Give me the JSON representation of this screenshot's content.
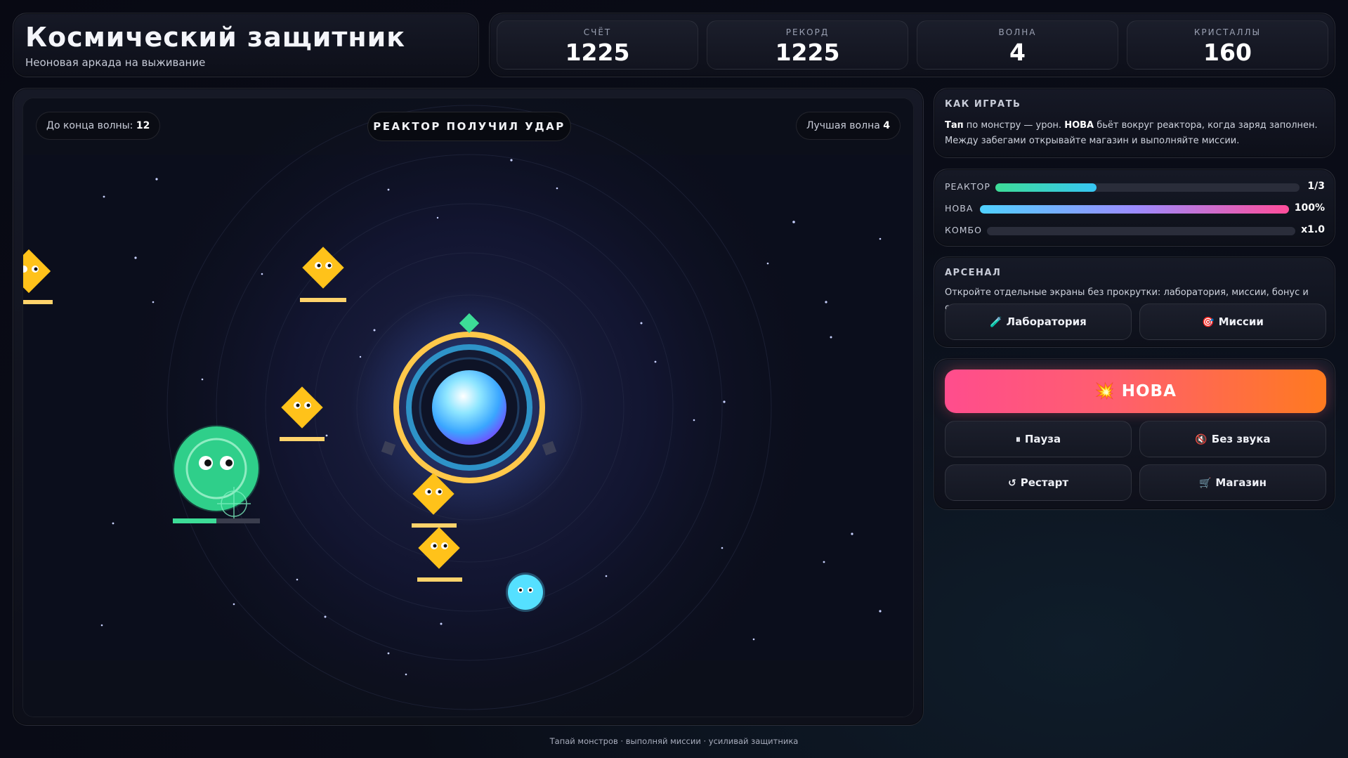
{
  "header": {
    "title": "Космический защитник",
    "subtitle": "Неоновая аркада на выживание"
  },
  "stats": [
    {
      "label": "СЧЁТ",
      "value": "1225"
    },
    {
      "label": "РЕКОРД",
      "value": "1225"
    },
    {
      "label": "ВОЛНА",
      "value": "4"
    },
    {
      "label": "КРИСТАЛЛЫ",
      "value": "160"
    }
  ],
  "game": {
    "wave_left_label": "До конца волны:",
    "wave_left_value": "12",
    "hit_message": "РЕАКТОР ПОЛУЧИЛ УДАР",
    "best_wave_label": "Лучшая волна",
    "best_wave_value": "4",
    "boss_health_fraction": 0.5
  },
  "howto": {
    "title": "КАК ИГРАТЬ",
    "tap": "Тап",
    "text1": " по монстру — урон. ",
    "nova": "НОВА",
    "text2": " бьёт вокруг реактора, когда заряд заполнен. Между забегами открывайте магазин и выполняйте миссии."
  },
  "bars": {
    "reactor": {
      "label": "РЕАКТОР",
      "value": "1/3",
      "fraction": 0.333,
      "color_from": "#3ddc97",
      "color_to": "#37c6f4"
    },
    "nova": {
      "label": "НОВА",
      "value": "100%",
      "fraction": 1.0,
      "color_from": "#4fd1ff",
      "color_to": "#ff4d9a"
    },
    "combo": {
      "label": "КОМБО",
      "value": "x1.0",
      "fraction": 0.0
    }
  },
  "arsenal": {
    "title": "АРСЕНАЛ",
    "text": "Откройте отдельные экраны без прокрутки: лаборатория, миссии, бонус и скины.",
    "lab_icon": "🧪",
    "lab_label": "Лаборатория",
    "missions_icon": "🎯",
    "missions_label": "Миссии"
  },
  "actions": {
    "nova_icon": "💥",
    "nova_label": "НОВА",
    "pause_icon": "⏸",
    "pause_label": "Пауза",
    "mute_icon": "🔇",
    "mute_label": "Без звука",
    "restart_icon": "↺",
    "restart_label": "Рестарт",
    "shop_icon": "🛒",
    "shop_label": "Магазин"
  },
  "footer": "Тапай монстров · выполняй миссии · усиливай защитника",
  "colors": {
    "accent_green": "#3ddc97",
    "enemy_yellow": "#ffc21a",
    "reactor_ring": "#ffc84a",
    "nova_gradient_from": "#ff4d8d",
    "nova_gradient_to": "#ff7a1f"
  }
}
